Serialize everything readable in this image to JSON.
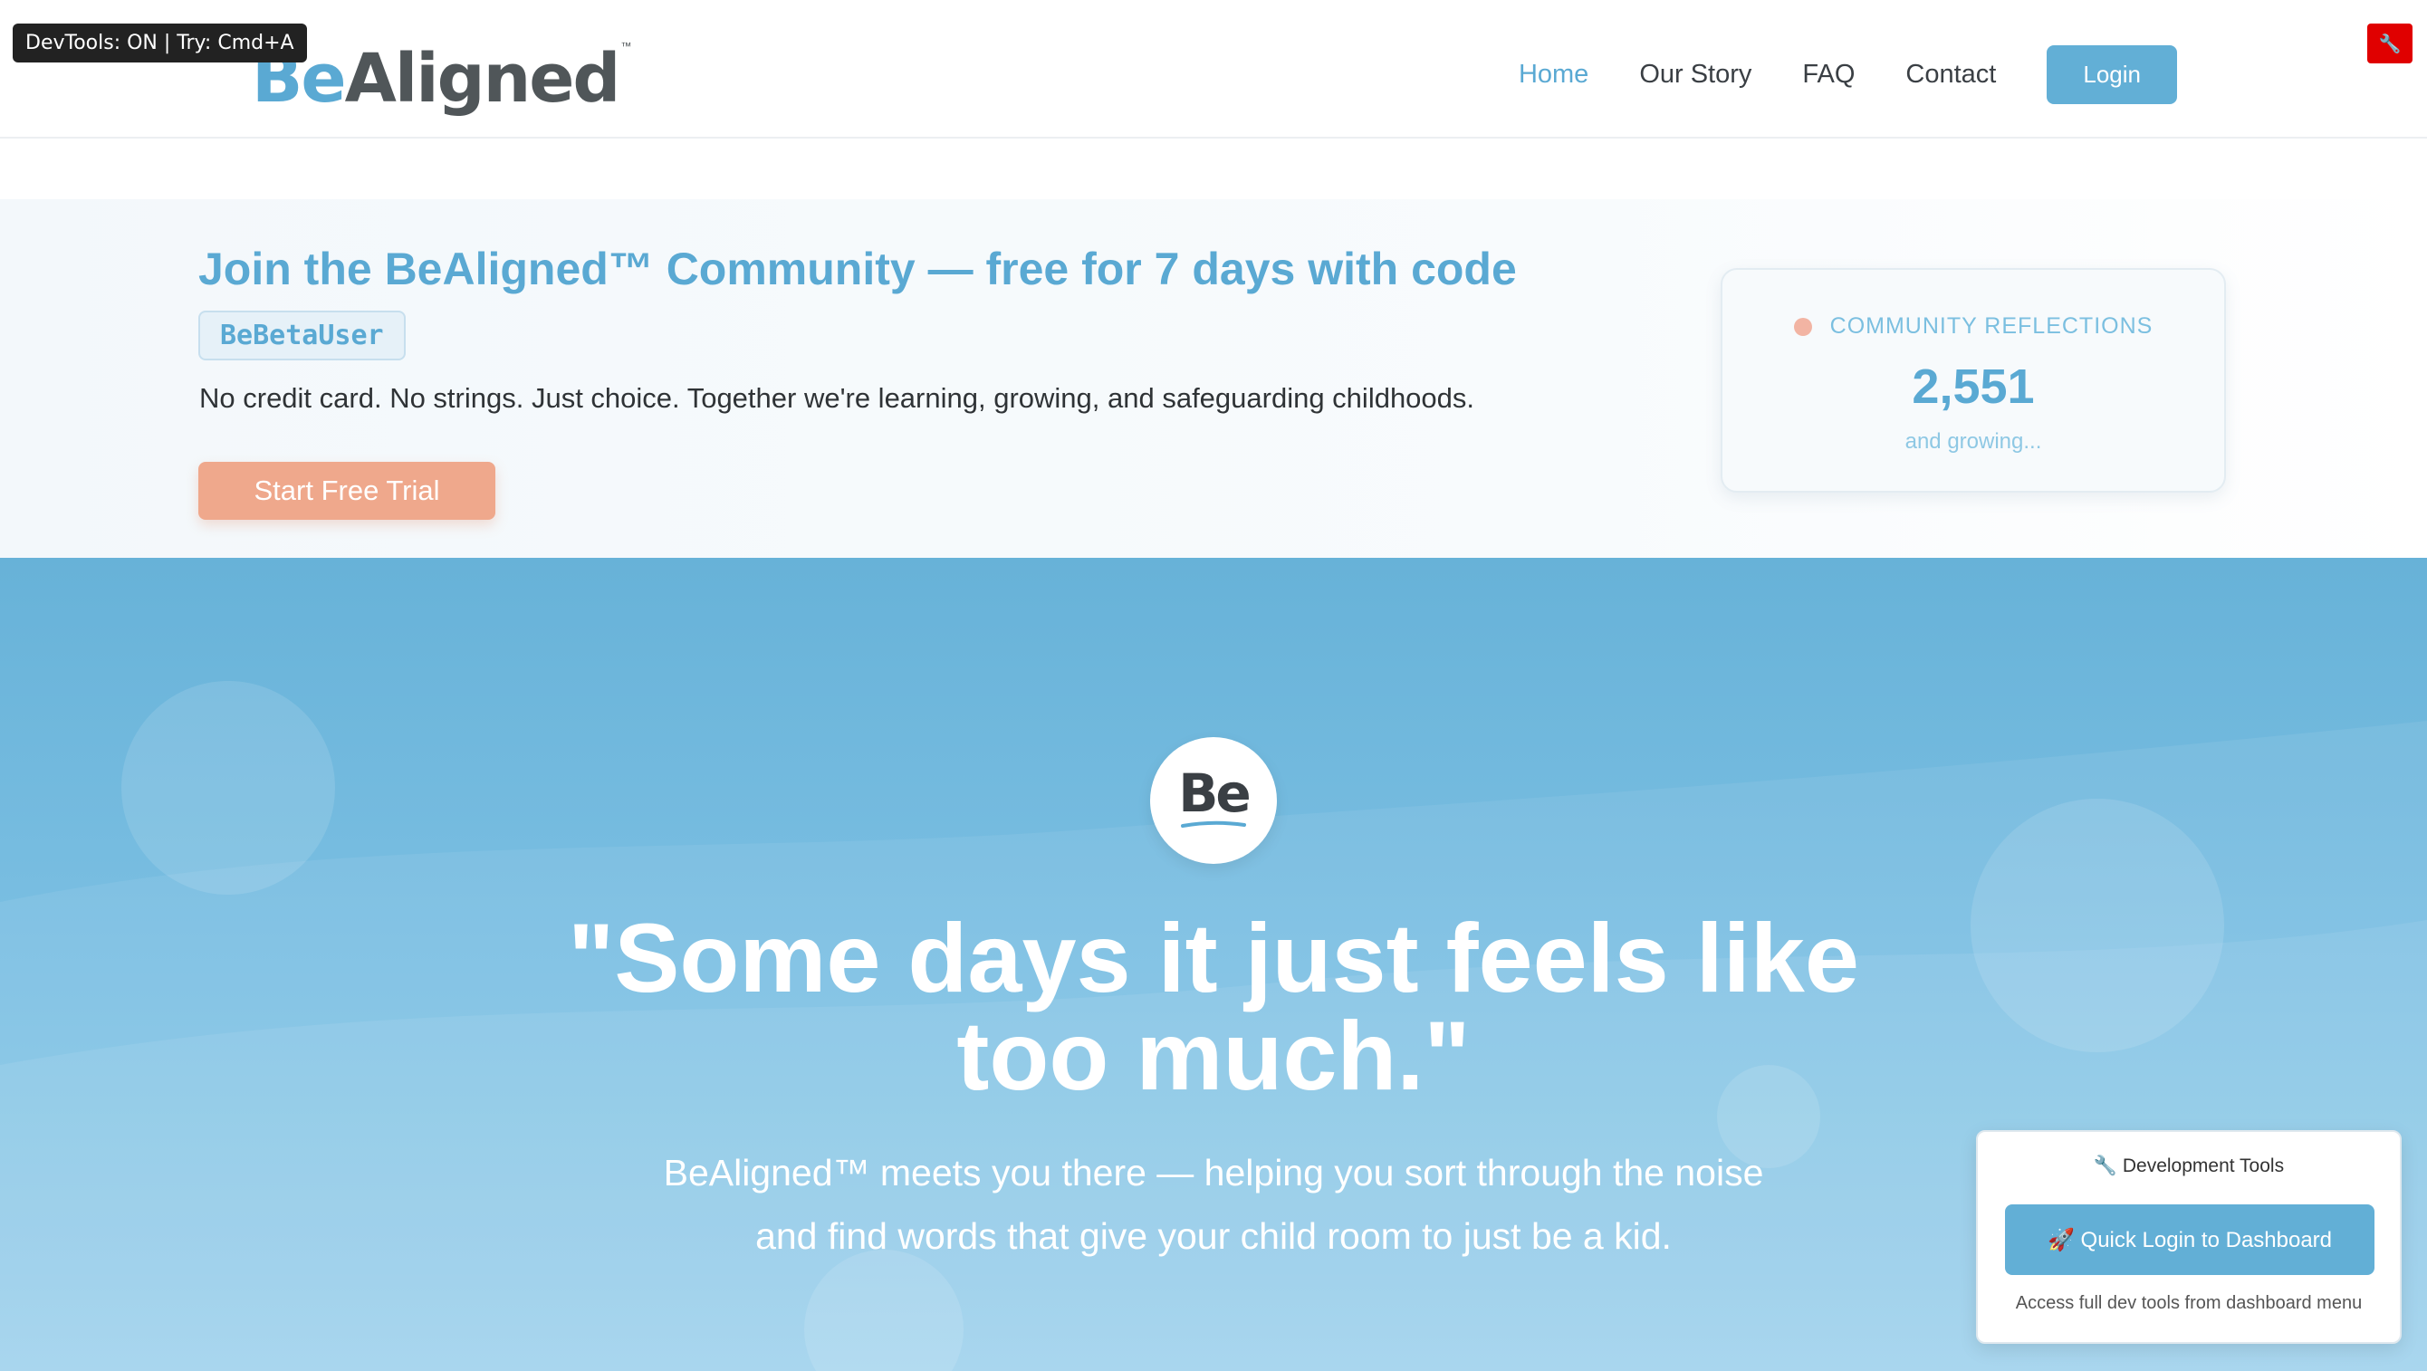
{
  "devtools_badge": "DevTools: ON | Try: Cmd+A",
  "header": {
    "logo_be": "Be",
    "logo_aligned": "Aligned",
    "logo_tm": "™",
    "nav": [
      {
        "label": "Home",
        "active": true
      },
      {
        "label": "Our Story",
        "active": false
      },
      {
        "label": "FAQ",
        "active": false
      },
      {
        "label": "Contact",
        "active": false
      }
    ],
    "login_label": "Login"
  },
  "wrench_icon": "🔧",
  "promo": {
    "title": "Join the BeAligned™ Community — free for 7 days with code",
    "code": "BeBetaUser",
    "subtitle": "No credit card. No strings. Just choice. Together we're learning, growing, and safeguarding childhoods.",
    "cta_label": "Start Free Trial",
    "stats": {
      "label": "COMMUNITY REFLECTIONS",
      "count": "2,551",
      "suffix": "and growing..."
    }
  },
  "hero": {
    "badge_text": "Be",
    "quote": "\"Some days it just feels like too much.\"",
    "subtitle_line1": "BeAligned™ meets you there — helping you sort through the noise",
    "subtitle_line2": "and find words that give your child room to just be a kid."
  },
  "dev_panel": {
    "title": "🔧 Development Tools",
    "button_label": "🚀 Quick Login to Dashboard",
    "note": "Access full dev tools from dashboard menu"
  },
  "colors": {
    "brand_blue": "#5aa9d3",
    "brand_coral": "#efa88c",
    "hero_top": "#67b2d8",
    "hero_bottom": "#9bd0ec",
    "dev_red": "#e00000"
  }
}
